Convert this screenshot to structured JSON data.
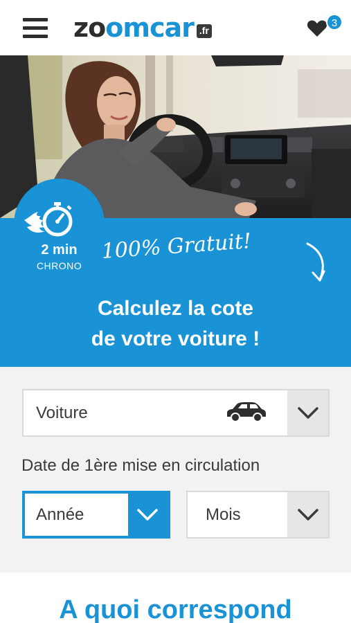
{
  "header": {
    "menu_icon": "hamburger-menu-icon",
    "logo": {
      "main": "zo",
      "accent": "om",
      "end": "car",
      "tld": ".fr"
    },
    "favorites": {
      "icon": "heart-icon",
      "count": "3"
    }
  },
  "hero": {
    "image": "woman-in-car-photo"
  },
  "banner": {
    "chrono_icon": "stopwatch-fire-icon",
    "chrono_time": "2 min",
    "chrono_label": "CHRONO",
    "free_text": "100% Gratuit!",
    "arrow_icon": "curved-arrow-down-icon",
    "title_line1": "Calculez la cote",
    "title_line2": "de votre voiture !"
  },
  "form": {
    "vehicle_select": {
      "value": "Voiture",
      "icon": "car-icon"
    },
    "date_label": "Date de 1ère mise en circulation",
    "year_select": {
      "value": "Année"
    },
    "month_select": {
      "value": "Mois"
    }
  },
  "section": {
    "title": "A quoi correspond"
  },
  "colors": {
    "accent": "#1a93d6",
    "dark": "#2d2d2d",
    "background": "#f2f2f2"
  }
}
